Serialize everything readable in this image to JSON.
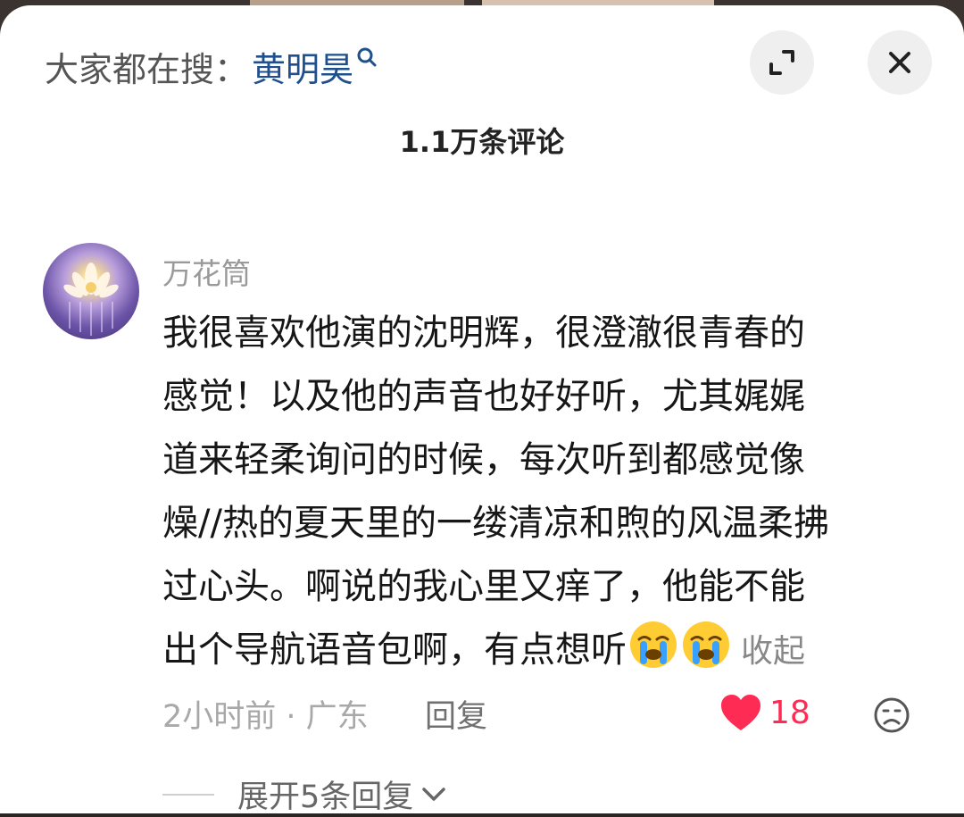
{
  "search": {
    "prefix": "大家都在搜：",
    "term": "黄明昊"
  },
  "header": {
    "comment_count": "1.1万条评论"
  },
  "comment": {
    "author": "万花筒",
    "lines": [
      "我很喜欢他演的沈明辉，很澄澈很青春的",
      "感觉！以及他的声音也好好听，尤其娓娓",
      "道来轻柔询问的时候，每次听到都感觉像",
      "燥//热的夏天里的一缕清凉和煦的风温柔拂",
      "过心头。啊说的我心里又痒了，他能不能",
      "出个导航语音包啊，有点想听"
    ],
    "collapse_label": "收起",
    "time_location": "2小时前 · 广东",
    "reply_label": "回复",
    "like_count": "18",
    "expand_replies_label": "展开5条回复"
  },
  "colors": {
    "like": "#fe2c55",
    "search_term": "#1f4f8c"
  },
  "icons": [
    "search-icon",
    "expand-icon",
    "close-icon",
    "crying-emoji",
    "heart-icon",
    "dislike-face-icon",
    "chevron-down-icon"
  ]
}
